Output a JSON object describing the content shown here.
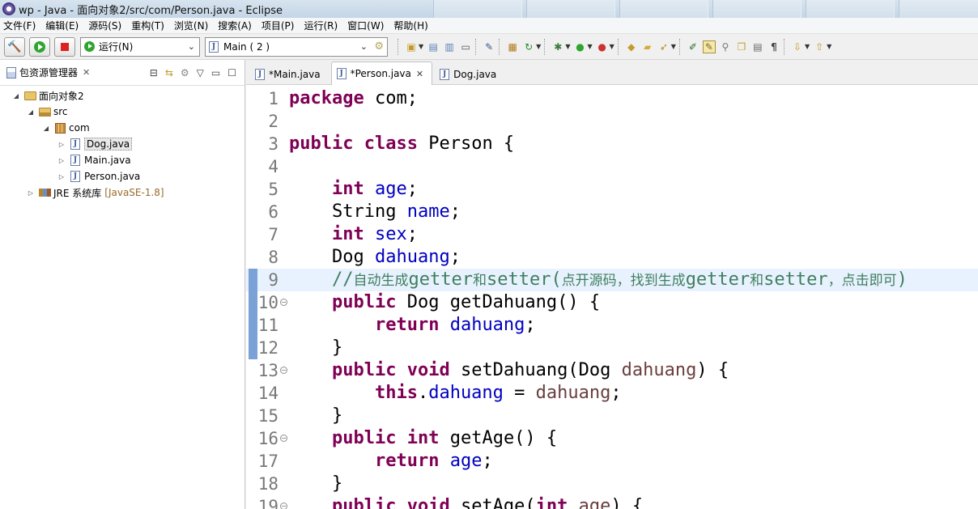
{
  "window": {
    "title": "wp  -  Java  -  面向对象2/src/com/Person.java  -  Eclipse"
  },
  "menu": [
    "文件(F)",
    "编辑(E)",
    "源码(S)",
    "重构(T)",
    "浏览(N)",
    "搜索(A)",
    "项目(P)",
    "运行(R)",
    "窗口(W)",
    "帮助(H)"
  ],
  "toolbar": {
    "run_mode": "运行(N)",
    "launch_config": "Main ( 2 )"
  },
  "package_explorer": {
    "title": "包资源管理器",
    "project": "面向对象2",
    "src": "src",
    "package": "com",
    "files": [
      "Dog.java",
      "Main.java",
      "Person.java"
    ],
    "jre": "JRE 系统库",
    "jre_version": "[JavaSE-1.8]"
  },
  "tabs": [
    {
      "label": "*Main.java"
    },
    {
      "label": "*Person.java"
    },
    {
      "label": "Dog.java"
    }
  ],
  "code": {
    "lines": [
      {
        "n": "1",
        "tokens": [
          [
            "k",
            "package"
          ],
          [
            "p",
            " com;"
          ]
        ]
      },
      {
        "n": "2",
        "tokens": []
      },
      {
        "n": "3",
        "tokens": [
          [
            "k",
            "public"
          ],
          [
            "p",
            " "
          ],
          [
            "k",
            "class"
          ],
          [
            "p",
            " Person {"
          ]
        ]
      },
      {
        "n": "4",
        "tokens": []
      },
      {
        "n": "5",
        "tokens": [
          [
            "p",
            "    "
          ],
          [
            "k",
            "int"
          ],
          [
            "p",
            " "
          ],
          [
            "f",
            "age"
          ],
          [
            "p",
            ";"
          ]
        ]
      },
      {
        "n": "6",
        "tokens": [
          [
            "p",
            "    String "
          ],
          [
            "f",
            "name"
          ],
          [
            "p",
            ";"
          ]
        ]
      },
      {
        "n": "7",
        "tokens": [
          [
            "p",
            "    "
          ],
          [
            "k",
            "int"
          ],
          [
            "p",
            " "
          ],
          [
            "f",
            "sex"
          ],
          [
            "p",
            ";"
          ]
        ]
      },
      {
        "n": "8",
        "tokens": [
          [
            "p",
            "    Dog "
          ],
          [
            "f",
            "dahuang"
          ],
          [
            "p",
            ";"
          ]
        ]
      },
      {
        "n": "9",
        "tokens": [
          [
            "p",
            "    "
          ],
          [
            "c",
            "//"
          ],
          [
            "cz",
            "自动生成"
          ],
          [
            "c",
            "getter"
          ],
          [
            "cz",
            "和"
          ],
          [
            "c",
            "setter("
          ],
          [
            "cz",
            "点开源码，找到生成"
          ],
          [
            "c",
            "getter"
          ],
          [
            "cz",
            "和"
          ],
          [
            "c",
            "setter"
          ],
          [
            "cz",
            "，点击即可"
          ],
          [
            "c",
            ")"
          ]
        ]
      },
      {
        "n": "10",
        "tokens": [
          [
            "p",
            "    "
          ],
          [
            "k",
            "public"
          ],
          [
            "p",
            " Dog getDahuang() {"
          ]
        ]
      },
      {
        "n": "11",
        "tokens": [
          [
            "p",
            "        "
          ],
          [
            "k",
            "return"
          ],
          [
            "p",
            " "
          ],
          [
            "f",
            "dahuang"
          ],
          [
            "p",
            ";"
          ]
        ]
      },
      {
        "n": "12",
        "tokens": [
          [
            "p",
            "    }"
          ]
        ]
      },
      {
        "n": "13",
        "tokens": [
          [
            "p",
            "    "
          ],
          [
            "k",
            "public"
          ],
          [
            "p",
            " "
          ],
          [
            "k",
            "void"
          ],
          [
            "p",
            " setDahuang(Dog "
          ],
          [
            "a",
            "dahuang"
          ],
          [
            "p",
            ") {"
          ]
        ]
      },
      {
        "n": "14",
        "tokens": [
          [
            "p",
            "        "
          ],
          [
            "k",
            "this"
          ],
          [
            "p",
            "."
          ],
          [
            "f",
            "dahuang"
          ],
          [
            "p",
            " = "
          ],
          [
            "a",
            "dahuang"
          ],
          [
            "p",
            ";"
          ]
        ]
      },
      {
        "n": "15",
        "tokens": [
          [
            "p",
            "    }"
          ]
        ]
      },
      {
        "n": "16",
        "tokens": [
          [
            "p",
            "    "
          ],
          [
            "k",
            "public"
          ],
          [
            "p",
            " "
          ],
          [
            "k",
            "int"
          ],
          [
            "p",
            " getAge() {"
          ]
        ]
      },
      {
        "n": "17",
        "tokens": [
          [
            "p",
            "        "
          ],
          [
            "k",
            "return"
          ],
          [
            "p",
            " "
          ],
          [
            "f",
            "age"
          ],
          [
            "p",
            ";"
          ]
        ]
      },
      {
        "n": "18",
        "tokens": [
          [
            "p",
            "    }"
          ]
        ]
      },
      {
        "n": "19",
        "tokens": [
          [
            "p",
            "    "
          ],
          [
            "k",
            "public"
          ],
          [
            "p",
            " "
          ],
          [
            "k",
            "void"
          ],
          [
            "p",
            " setAge("
          ],
          [
            "k",
            "int"
          ],
          [
            "p",
            " "
          ],
          [
            "a",
            "age"
          ],
          [
            "p",
            ") {"
          ]
        ]
      }
    ]
  }
}
